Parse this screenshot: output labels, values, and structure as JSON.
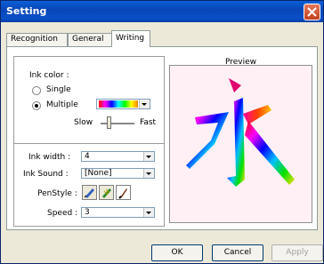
{
  "window": {
    "title": "Setting"
  },
  "tabs": [
    "Recognition",
    "General",
    "Writing"
  ],
  "writing": {
    "ink_color_label": "Ink color :",
    "single_label": "Single",
    "multiple_label": "Multiple",
    "multiple_selected": true,
    "slow_label": "Slow",
    "fast_label": "Fast",
    "ink_width_label": "Ink width :",
    "ink_width_value": "4",
    "ink_sound_label": "Ink Sound :",
    "ink_sound_value": "[None]",
    "penstyle_label": "PenStyle :",
    "speed_label": "Speed :",
    "speed_value": "3",
    "preview_label": "Preview"
  },
  "buttons": {
    "ok": "OK",
    "cancel": "Cancel",
    "apply": "Apply"
  },
  "colors": {
    "titlebar": "#0a50c8",
    "preview_bg": "#fff0f5"
  }
}
